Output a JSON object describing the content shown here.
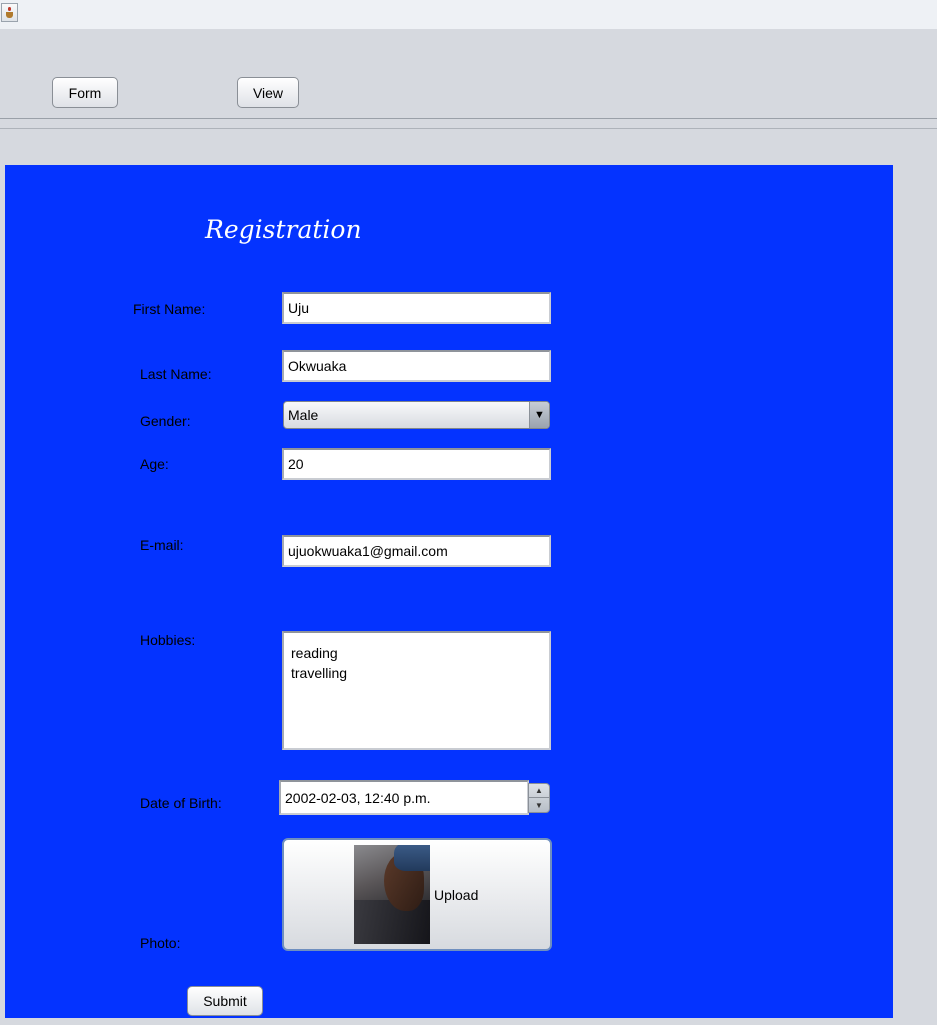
{
  "window": {
    "icon": "java-coffee-cup-icon"
  },
  "toolbar": {
    "form_label": "Form",
    "view_label": "View"
  },
  "form": {
    "heading": "Registration",
    "first_name_label": "First Name:",
    "first_name_value": "Uju",
    "last_name_label": "Last Name:",
    "last_name_value": "Okwuaka",
    "gender_label": "Gender:",
    "gender_value": "Male",
    "age_label": "Age:",
    "age_value": "20",
    "email_label": "E-mail:",
    "email_value": "ujuokwuaka1@gmail.com",
    "hobbies_label": "Hobbies:",
    "hobbies_lines": [
      "reading",
      "travelling"
    ],
    "dob_label": "Date of Birth:",
    "dob_value": "2002-02-03, 12:40 p.m.",
    "photo_label": "Photo:",
    "upload_label": "Upload",
    "submit_label": "Submit"
  },
  "colors": {
    "panel_bg": "#0433ff",
    "window_bg": "#d6d9df",
    "heading_color": "#ffffff"
  }
}
